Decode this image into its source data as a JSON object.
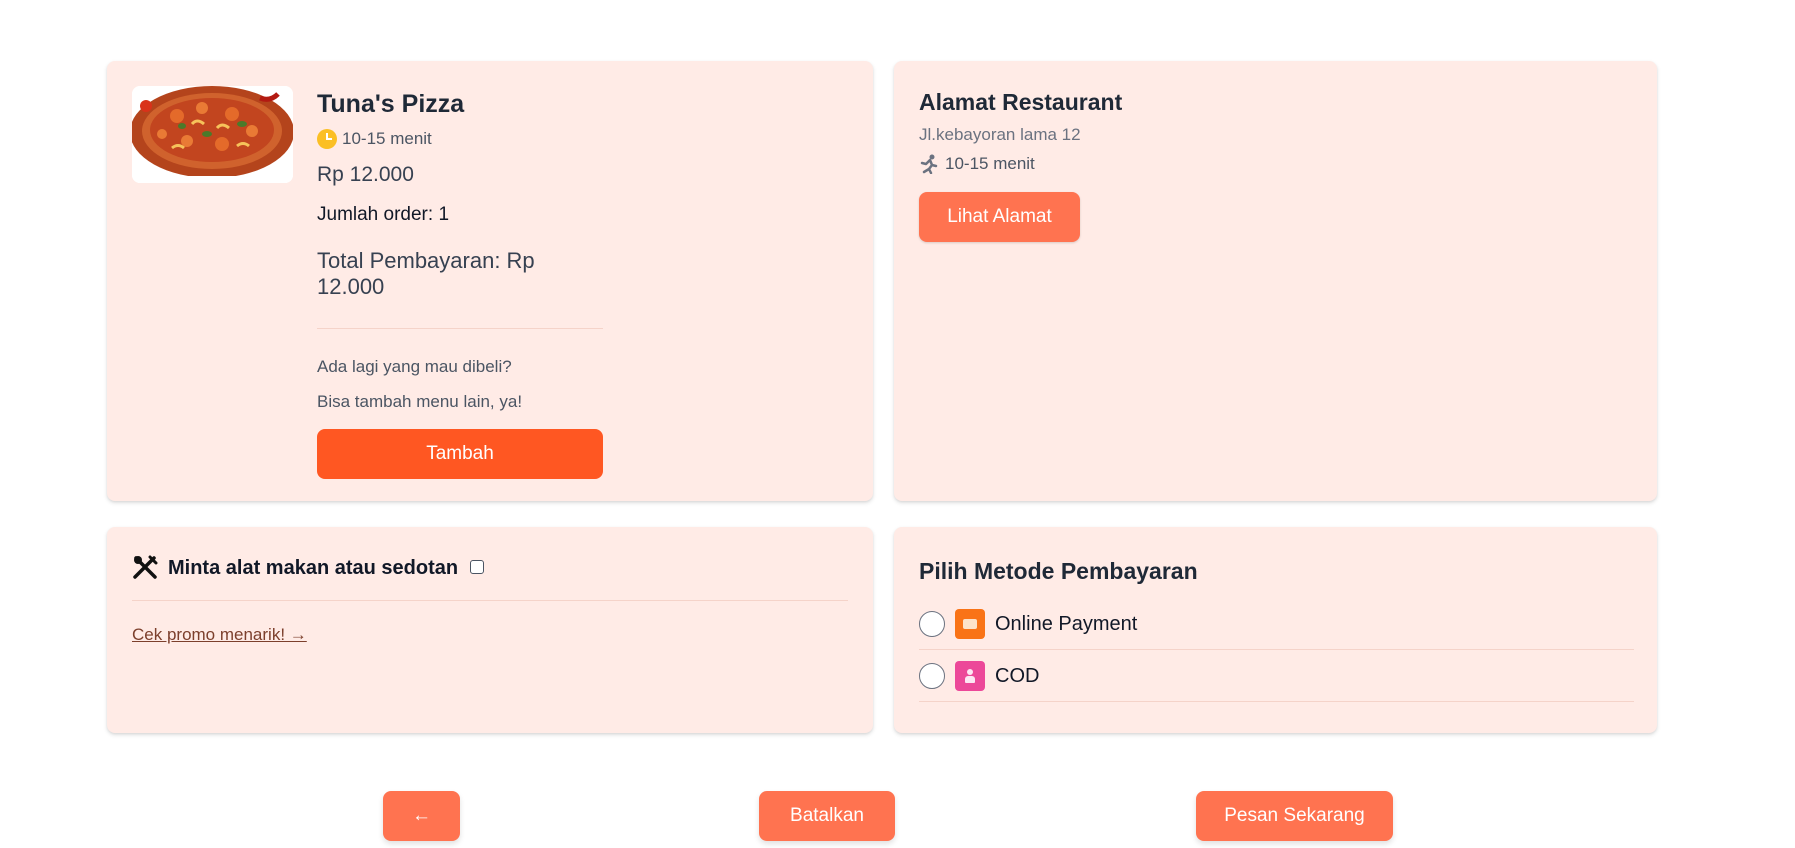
{
  "product": {
    "name": "Tuna's Pizza",
    "eta": "10-15 menit",
    "price": "Rp 12.000",
    "quantity": "Jumlah order: 1",
    "total": "Total Pembayaran: Rp 12.000",
    "prompt_line1": "Ada lagi yang mau dibeli?",
    "prompt_line2": "Bisa tambah menu lain, ya!",
    "add_button": "Tambah"
  },
  "address": {
    "title": "Alamat Restaurant",
    "street": "Jl.kebayoran lama 12",
    "eta": "10-15 menit",
    "view_button": "Lihat Alamat"
  },
  "utensils": {
    "label": "Minta alat makan atau sedotan",
    "checked": false,
    "promo_link": "Cek promo menarik! →"
  },
  "payment": {
    "title": "Pilih Metode Pembayaran",
    "options": [
      {
        "label": "Online Payment",
        "icon": "card-icon",
        "color": "#f97316",
        "selected": false
      },
      {
        "label": "COD",
        "icon": "person-icon",
        "color": "#ec4899",
        "selected": false
      }
    ]
  },
  "actions": {
    "back": "←",
    "cancel": "Batalkan",
    "order": "Pesan Sekarang"
  },
  "colors": {
    "card_bg": "#ffebe6",
    "primary_button": "#ff5722",
    "secondary_button": "#ff7350"
  }
}
